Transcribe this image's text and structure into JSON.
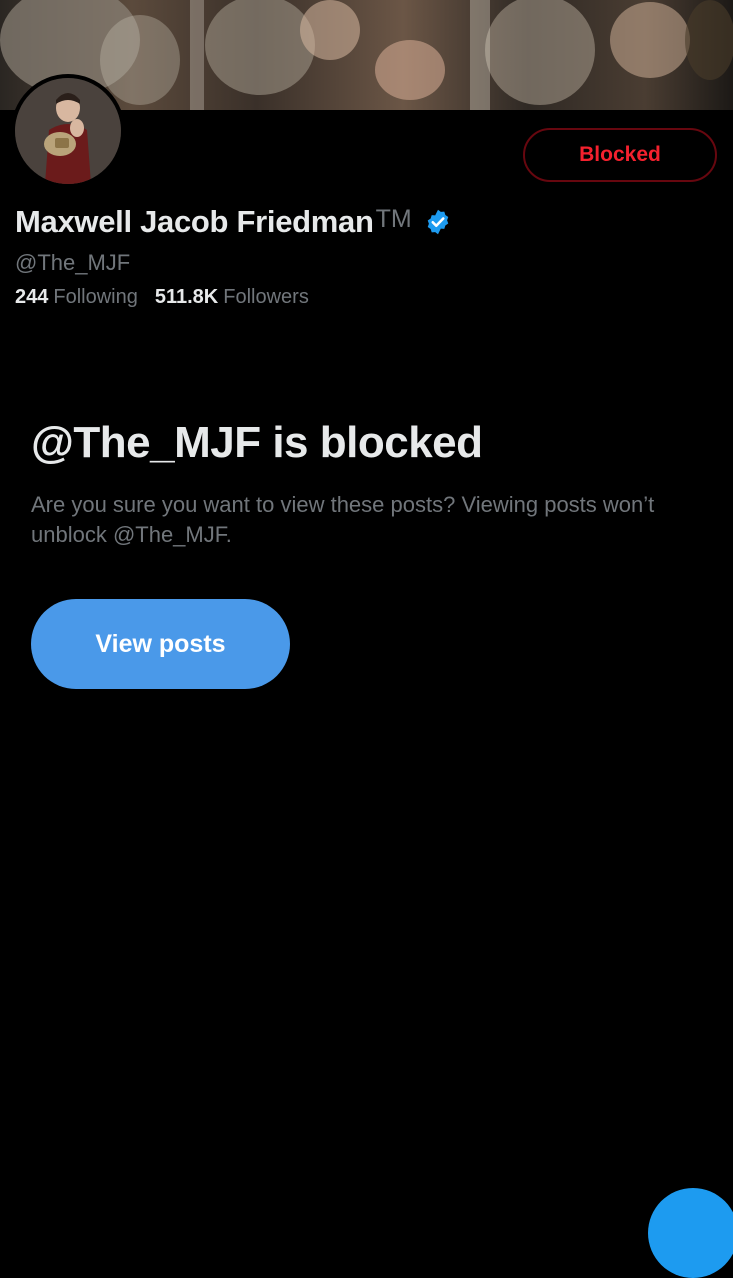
{
  "profile": {
    "display_name": "Maxwell Jacob Friedman",
    "trademark": "TM",
    "handle": "@The_MJF",
    "following_count": "244",
    "following_label": "Following",
    "followers_count": "511.8K",
    "followers_label": "Followers",
    "verified": true
  },
  "actions": {
    "blocked_label": "Blocked"
  },
  "blocked_notice": {
    "title": "@The_MJF is blocked",
    "description": "Are you sure you want to view these posts? Viewing posts won’t unblock @The_MJF.",
    "view_posts_label": "View posts"
  },
  "colors": {
    "background": "#000000",
    "primary_text": "#e7e9ea",
    "secondary_text": "#71767b",
    "blocked_red": "#f4212e",
    "accent_blue": "#4a99e9"
  },
  "icons": {
    "verified": "verified-badge-icon"
  }
}
